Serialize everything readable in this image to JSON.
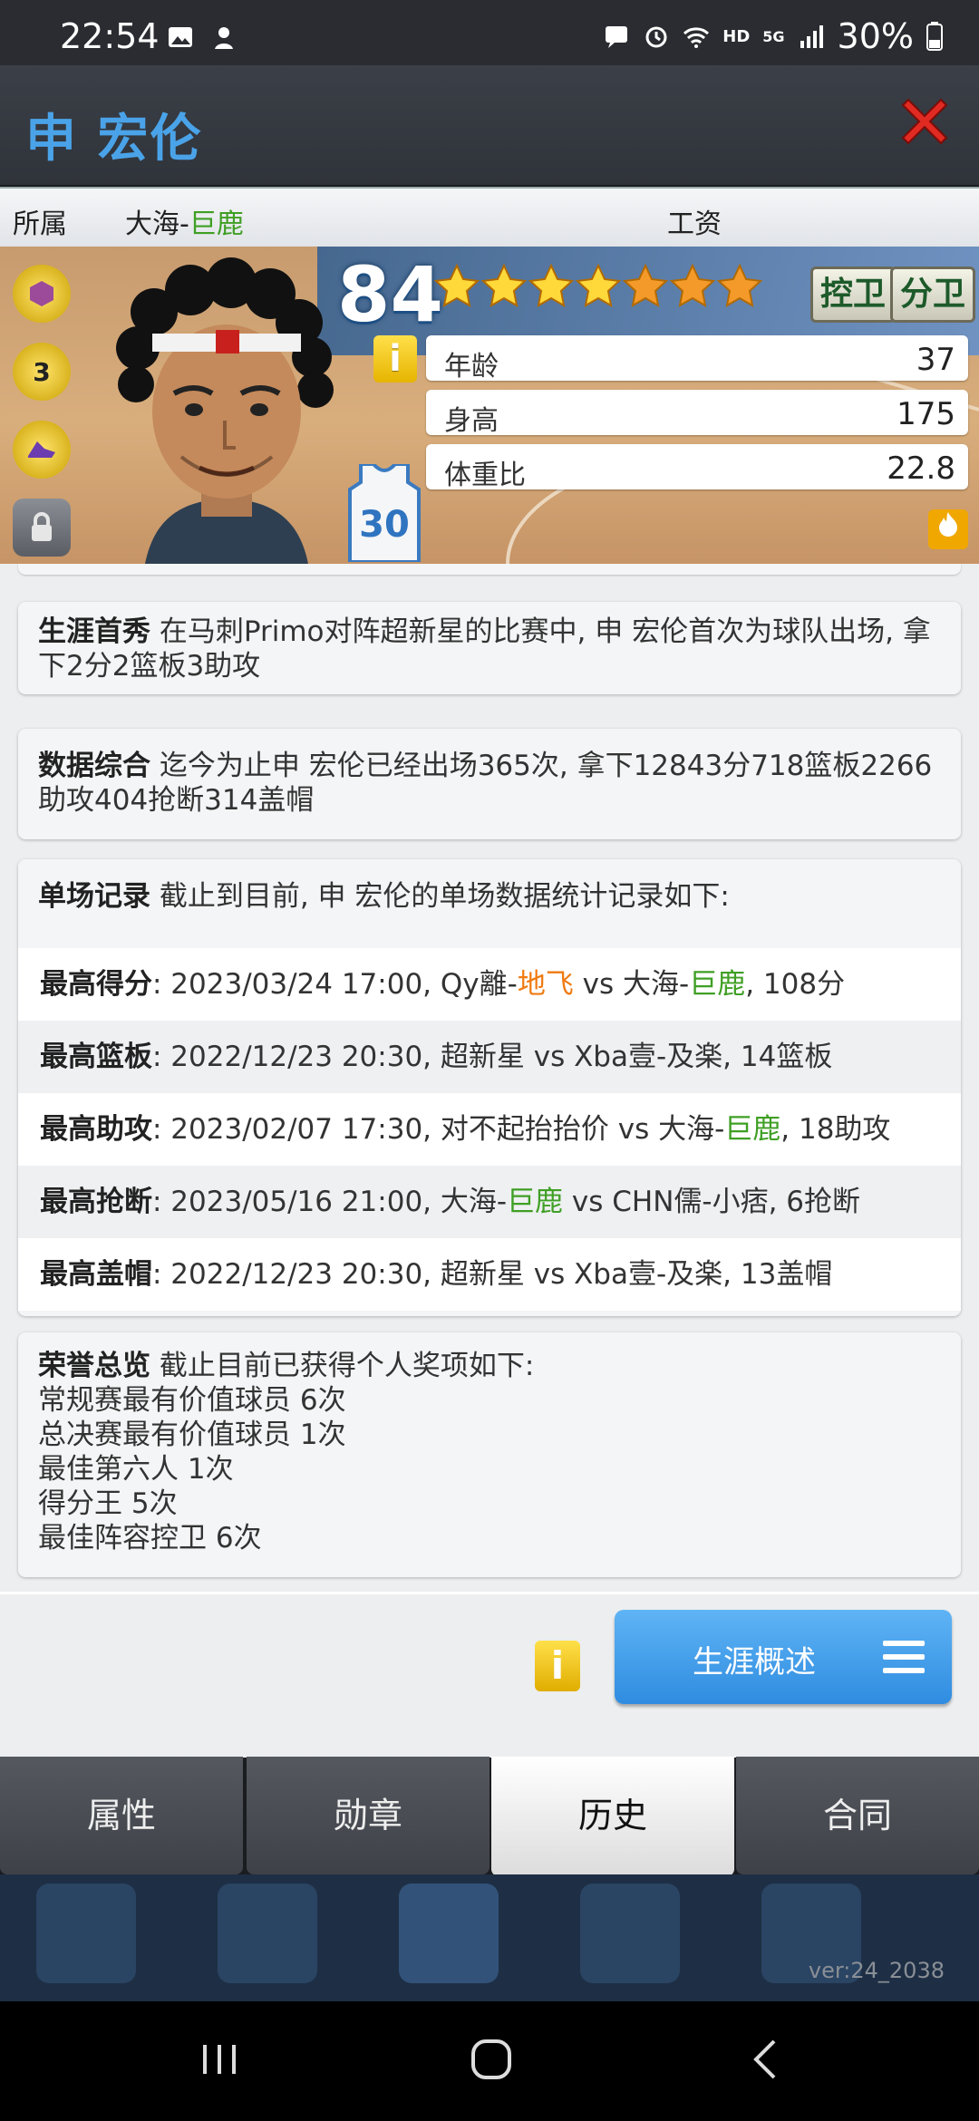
{
  "status_bar": {
    "time": "22:54",
    "battery": "30%",
    "icons": [
      "image-icon",
      "app-icon",
      "message-icon",
      "alarm-icon",
      "wifi-icon",
      "hd-icon",
      "signal-5g-icon",
      "battery-icon"
    ],
    "hd_label": "HD",
    "network_label": "5G"
  },
  "header": {
    "title": "申 宏伦",
    "close_icon": "close-icon"
  },
  "info_strip": {
    "team_label": "所属",
    "team_prefix": "大海-",
    "team_name": "巨鹿",
    "salary_label": "工资"
  },
  "player": {
    "rating": "84",
    "stars_filled": 4,
    "stars_total": 7,
    "positions": [
      "控卫",
      "分卫"
    ],
    "info_label": "i",
    "stats": [
      {
        "label": "年龄",
        "value": "37"
      },
      {
        "label": "身高",
        "value": "175"
      },
      {
        "label": "体重比",
        "value": "22.8"
      }
    ],
    "jersey_number": "30",
    "badge_number": "3",
    "fire_icon": "fire-icon",
    "lock_icon": "lock-icon"
  },
  "debut": {
    "title": "生涯首秀",
    "text": " 在马刺Primo对阵超新星的比赛中, 申 宏伦首次为球队出场, 拿下2分2篮板3助攻"
  },
  "summary": {
    "title": "数据综合",
    "text": " 迄今为止申 宏伦已经出场365次, 拿下12843分718篮板2266助攻404抢断314盖帽"
  },
  "records": {
    "title": "单场记录",
    "intro": " 截止到目前, 申 宏伦的单场数据统计记录如下:",
    "items": [
      {
        "label": "最高得分",
        "pre": ": 2023/03/24 17:00, Qy離-",
        "hl1": "地飞",
        "mid": " vs 大海-",
        "hl2": "巨鹿",
        "post": ", 108分"
      },
      {
        "label": "最高篮板",
        "pre": ": 2022/12/23 20:30, 超新星 vs Xba壹-及楽, 14篮板",
        "hl1": "",
        "mid": "",
        "hl2": "",
        "post": ""
      },
      {
        "label": "最高助攻",
        "pre": ": 2023/02/07 17:30, 对不起抬抬价 vs 大海-",
        "hl1": "",
        "mid": "",
        "hl2": "巨鹿",
        "post": ", 18助攻"
      },
      {
        "label": "最高抢断",
        "pre": ": 2023/05/16 21:00, 大海-",
        "hl1": "",
        "mid": "",
        "hl2": "巨鹿",
        "post": " vs CHN儒-小痞, 6抢断"
      },
      {
        "label": "最高盖帽",
        "pre": ": 2022/12/23 20:30, 超新星 vs Xba壹-及楽, 13盖帽",
        "hl1": "",
        "mid": "",
        "hl2": "",
        "post": ""
      }
    ]
  },
  "honors": {
    "title": "荣誉总览",
    "intro": " 截止目前已获得个人奖项如下:",
    "items": [
      "常规赛最有价值球员  6次",
      "总决赛最有价值球员  1次",
      "最佳第六人  1次",
      "得分王  5次",
      "最佳阵容控卫  6次"
    ]
  },
  "footer": {
    "info_label": "i",
    "career_button": "生涯概述"
  },
  "tabs": [
    "属性",
    "勋章",
    "历史",
    "合同"
  ],
  "active_tab": "历史",
  "version": "ver:24_2038",
  "colors": {
    "title_blue": "#4aa3e8",
    "team_green": "#3f9f24",
    "highlight_orange": "#f07a10",
    "button_blue": "#3a94e4"
  }
}
